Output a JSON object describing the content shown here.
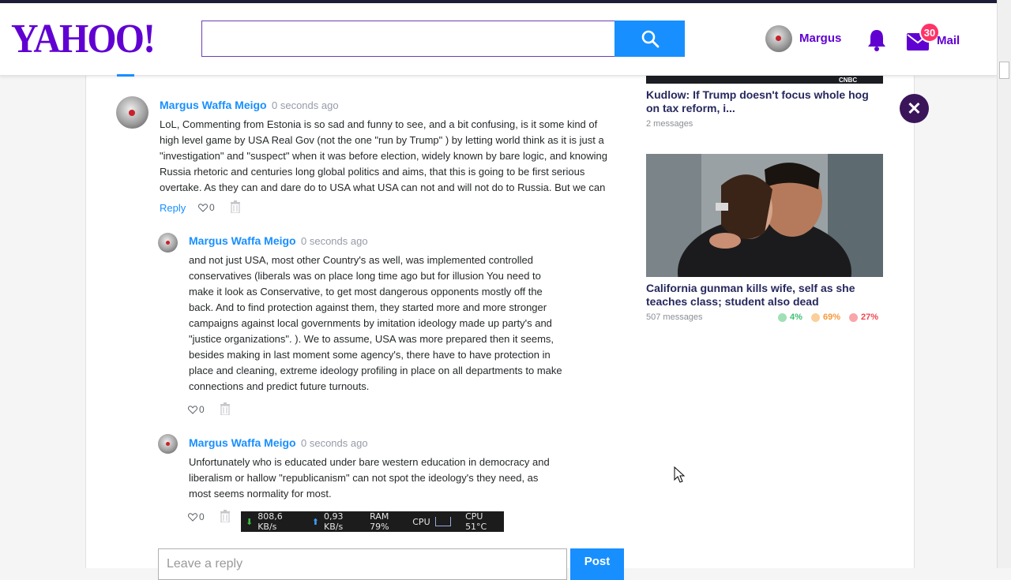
{
  "header": {
    "logo": "YAHOO!",
    "search_placeholder": "",
    "user_name": "Margus",
    "mail_count": "30",
    "mail_label": "Mail"
  },
  "comments": [
    {
      "author": "Margus Waffa Meigo",
      "time": "0 seconds ago",
      "text": "LoL, Commenting from Estonia is so sad and funny to see, and a bit confusing, is it some kind of high level game by USA Real Gov (not the one \"run by Trump\" ) by letting world think as it is just a \"investigation\" and \"suspect\" when it was before election, widely known by bare logic, and knowing Russia rhetoric and centuries long global politics and aims, that this is going to be first serious overtake. As they can and dare do to USA what USA can not and will not do to Russia. But we can",
      "reply_label": "Reply",
      "likes": "0"
    },
    {
      "author": "Margus Waffa Meigo",
      "time": "0 seconds ago",
      "text": "and not just USA, most other Country's as well, was implemented controlled conservatives (liberals was on place long time ago but for illusion You need to make it look as Conservative, to get most dangerous opponents mostly off the back. And to find protection against them, they started more and more stronger campaigns against local governments by imitation ideology made up party's and \"justice organizations\". ). We to assume, USA was more prepared then it seems, besides making in last moment some agency's, there have to have protection in place and cleaning, extreme ideology profiling in place on all departments to make connections and predict future turnouts.",
      "likes": "0"
    },
    {
      "author": "Margus Waffa Meigo",
      "time": "0 seconds ago",
      "text": "Unfortunately who is educated under bare western education in democracy and liberalism or hallow \"republicanism\" can not spot the ideology's they need, as most seems normality for most.",
      "likes": "0"
    }
  ],
  "reply_box": {
    "placeholder": "Leave a reply",
    "post_label": "Post"
  },
  "sidebar": {
    "stories": [
      {
        "source_badge": "CNBC",
        "title": "Kudlow: If Trump doesn't focus whole hog on tax reform, i...",
        "meta": "2 messages"
      },
      {
        "title": "California gunman kills wife, self as she teaches class; student also dead",
        "meta": "507 messages",
        "reactions": [
          {
            "value": "4%",
            "color": "#3fbf6f"
          },
          {
            "value": "69%",
            "color": "#f59a3b"
          },
          {
            "value": "27%",
            "color": "#f0474f"
          }
        ]
      }
    ]
  },
  "system_monitor": {
    "down": "808,6 KB/s",
    "up": "0,93 KB/s",
    "ram": "RAM 79%",
    "cpu_label": "CPU",
    "cpu_temp": "CPU 51°C"
  }
}
